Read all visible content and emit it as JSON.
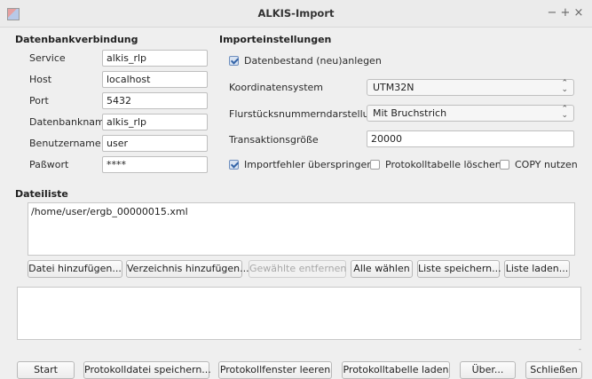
{
  "window": {
    "title": "ALKIS-Import",
    "controls": [
      "−",
      "+",
      "×"
    ]
  },
  "db": {
    "heading": "Datenbankverbindung",
    "fields": [
      {
        "label": "Service",
        "value": "alkis_rlp"
      },
      {
        "label": "Host",
        "value": "localhost"
      },
      {
        "label": "Port",
        "value": "5432"
      },
      {
        "label": "Datenbankname",
        "value": "alkis_rlp"
      },
      {
        "label": "Benutzername",
        "value": "user"
      },
      {
        "label": "Paßwort",
        "value": "****"
      }
    ]
  },
  "import": {
    "heading": "Importeinstellungen",
    "recreate_label": "Datenbestand (neu)anlegen",
    "recreate_checked": true,
    "crs_label": "Koordinatensystem",
    "crs_value": "UTM32N",
    "parcel_label": "Flurstücksnummerndarstellung",
    "parcel_value": "Mit Bruchstrich",
    "tx_label": "Transaktionsgröße",
    "tx_value": "20000",
    "skip_errors_label": "Importfehler überspringen",
    "skip_errors_checked": true,
    "clear_log_label": "Protokolltabelle löschen",
    "clear_log_checked": false,
    "copy_label": "COPY nutzen",
    "copy_checked": false
  },
  "files": {
    "heading": "Dateiliste",
    "items": [
      "/home/user/ergb_00000015.xml"
    ],
    "buttons": {
      "add_file": "Datei hinzufügen...",
      "add_dir": "Verzeichnis hinzufügen...",
      "remove": "Gewählte entfernen",
      "select_all": "Alle wählen",
      "save_list": "Liste speichern...",
      "load_list": "Liste laden..."
    }
  },
  "bottom": {
    "start": "Start",
    "save_log": "Protokolldatei speichern...",
    "clear_log_window": "Protokollfenster leeren",
    "load_log_table": "Protokolltabelle laden",
    "about": "Über...",
    "close": "Schließen"
  }
}
